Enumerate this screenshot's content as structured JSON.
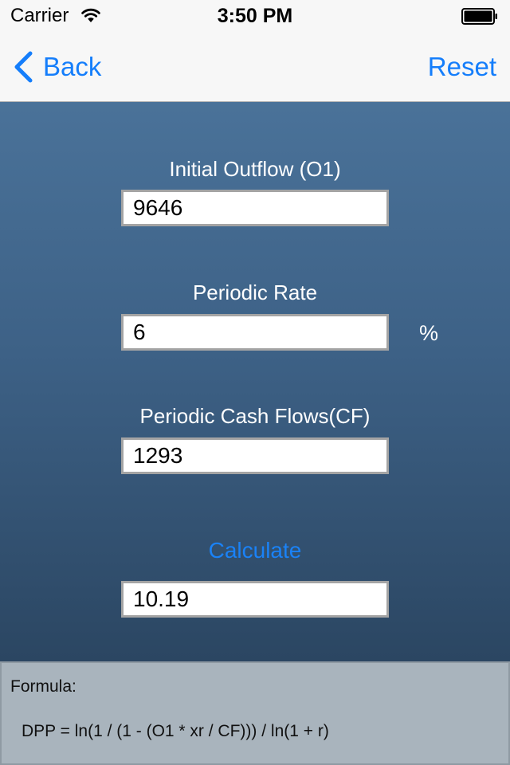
{
  "status_bar": {
    "carrier": "Carrier",
    "time": "3:50 PM",
    "wifi_icon": "wifi-icon",
    "battery_icon": "battery-icon"
  },
  "nav": {
    "back_label": "Back",
    "reset_label": "Reset",
    "accent_color": "#157efb"
  },
  "form": {
    "initial_outflow": {
      "label": "Initial Outflow (O1)",
      "value": "9646"
    },
    "periodic_rate": {
      "label": "Periodic Rate",
      "value": "6",
      "unit": "%"
    },
    "periodic_cash_flows": {
      "label": "Periodic Cash Flows(CF)",
      "value": "1293"
    },
    "calculate_label": "Calculate",
    "result_value": "10.19"
  },
  "formula": {
    "title": "Formula:",
    "text": "DPP = ln(1 / (1 - (O1 * xr / CF))) / ln(1 + r)"
  }
}
